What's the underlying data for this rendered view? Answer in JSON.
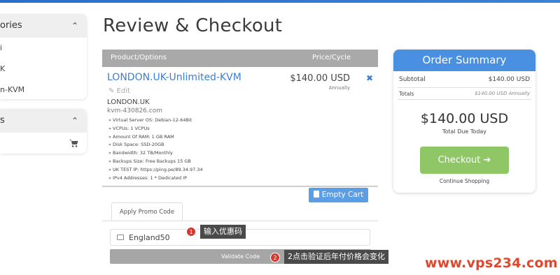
{
  "sidebar": {
    "categories_title": "ories",
    "category_items": [
      "i",
      "K",
      "n-KVM"
    ],
    "actions_title": "s"
  },
  "page": {
    "title": "Review & Checkout"
  },
  "table": {
    "col_product": "Product/Options",
    "col_price": "Price/Cycle"
  },
  "item": {
    "name": "LONDON.UK-Unlimited-KVM",
    "edit_label": "Edit",
    "location": "LONDON.UK",
    "hostname": "kvm-430826.com",
    "price": "$140.00 USD",
    "cycle": "Annually",
    "remove_glyph": "✖",
    "specs": [
      "» Virtual Server OS: Debian-12-64Bit",
      "» VCPUs: 1 VCPUs",
      "» Amount Of RAM: 1 GB RAM",
      "» Disk Space: SSD-20GB",
      "» Bandwidth: 32 TB/Monthly",
      "» Backups Size: Free Backups 15 GB",
      "» UK TEST IP: https://ping.pe/89.34.97.34",
      "» IPv4 Addresses: 1 * Dedicated IP"
    ]
  },
  "actions": {
    "empty_cart": "Empty Cart"
  },
  "promo": {
    "tab_label": "Apply Promo Code",
    "code_value": "England50",
    "validate_label": "Validate Code"
  },
  "annotations": [
    {
      "number": "1",
      "text": "输入优惠码"
    },
    {
      "number": "2",
      "text": "2点击验证后年付价格会变化"
    }
  ],
  "summary": {
    "title": "Order Summary",
    "subtotal_label": "Subtotal",
    "subtotal_value": "$140.00 USD",
    "totals_label": "Totals",
    "totals_value": "$140.00 USD Annually",
    "total_amount": "$140.00 USD",
    "total_due_label": "Total Due Today",
    "checkout_label": "Checkout ➔",
    "continue_label": "Continue Shopping"
  },
  "watermark": "www.vps234.com",
  "colors": {
    "accent": "#4a90e2",
    "checkout": "#8fc766",
    "link": "#3d7fd1",
    "marker": "#d23a2f"
  }
}
